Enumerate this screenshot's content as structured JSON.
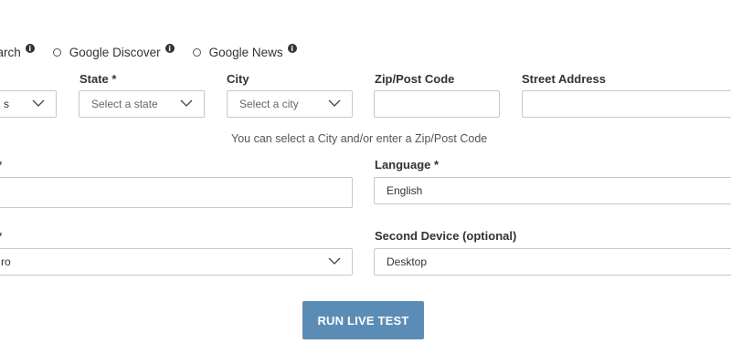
{
  "search_types": [
    {
      "label": "earch",
      "has_info": true
    },
    {
      "label": "Google Discover",
      "has_info": true
    },
    {
      "label": "Google News",
      "has_info": true
    }
  ],
  "info_glyph": "i",
  "location": {
    "country": {
      "value": "s"
    },
    "state": {
      "label": "State *",
      "placeholder": "Select a state"
    },
    "city": {
      "label": "City",
      "placeholder": "Select a city"
    },
    "zip": {
      "label": "Zip/Post Code",
      "value": ""
    },
    "street": {
      "label": "Street Address",
      "value": ""
    },
    "helper": "You can select a City and/or enter a Zip/Post Code"
  },
  "left_field_1": {
    "label": "*",
    "value": ""
  },
  "language": {
    "label": "Language *",
    "value": "English"
  },
  "left_field_2": {
    "label": "*",
    "value": "ro"
  },
  "second_device": {
    "label": "Second Device (optional)",
    "value": "Desktop"
  },
  "run_button": {
    "label": "RUN LIVE TEST"
  },
  "colors": {
    "button_bg": "#5b8cb6",
    "border": "#c8c8c8",
    "text": "#333333"
  }
}
